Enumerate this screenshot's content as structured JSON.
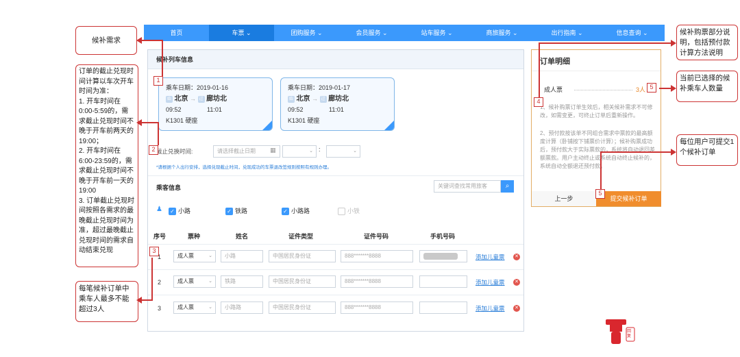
{
  "nav": {
    "items": [
      "首页",
      "车票 ⌄",
      "团购服务 ⌄",
      "会员服务 ⌄",
      "站车服务 ⌄",
      "商旅服务 ⌄",
      "出行指南 ⌄",
      "信息查询 ⌄"
    ]
  },
  "section1": {
    "title": "候补列车信息"
  },
  "tickets": [
    {
      "date": "乘车日期：2019-01-16",
      "from": "北京",
      "to": "廊坊北",
      "from_tag": "始",
      "to_tag": "过",
      "dep": "09:52",
      "arr": "11:01",
      "train": "K1301",
      "seat": "硬座"
    },
    {
      "date": "乘车日期：2019-01-17",
      "from": "北京",
      "to": "廊坊北",
      "from_tag": "始",
      "to_tag": "过",
      "dep": "09:52",
      "arr": "11:01",
      "train": "K1301",
      "seat": "硬座"
    }
  ],
  "deadline": {
    "label": "截止兑换时间:",
    "placeholder": "请选择截止日期",
    "colon": ":",
    "note": "*请根据个人出行安排，选择兑现截止时间，兑现成功的车票退改签规则按照有规则办理。"
  },
  "passengers_section": {
    "title": "乘客信息",
    "search_placeholder": "关键词查找常用旅客"
  },
  "passenger_checks": [
    {
      "name": "小路",
      "checked": true
    },
    {
      "name": "铁路",
      "checked": true
    },
    {
      "name": "小路路",
      "checked": true
    },
    {
      "name": "小铁",
      "checked": false
    }
  ],
  "table_headers": [
    "序号",
    "票种",
    "姓名",
    "证件类型",
    "证件号码",
    "手机号码"
  ],
  "rows": [
    {
      "no": "1",
      "ticket_type": "成人票",
      "name": "小路",
      "id_type": "中国居民身份证",
      "id_no": "888*******8888",
      "add_child": "添加儿童票"
    },
    {
      "no": "2",
      "ticket_type": "成人票",
      "name": "铁路",
      "id_type": "中国居民身份证",
      "id_no": "888*******8888",
      "add_child": "添加儿童票"
    },
    {
      "no": "3",
      "ticket_type": "成人票",
      "name": "小路路",
      "id_type": "中国居民身份证",
      "id_no": "888*******8888",
      "add_child": "添加儿童票"
    }
  ],
  "order": {
    "title": "订单明细",
    "item": "成人票",
    "count": "3人",
    "desc1": "1、候补购票订单生效后，相关候补需求不可修改，如需变更，可终止订单后重新操作。",
    "desc2": "2、预付款按该单不同组合需求中票款的最高额度计算（卧铺按下铺票价计算）；候补购票成功后，预付款大于实际票款的，系统将自动退回差额票款。用户主动终止或系统自动终止候补的，系统自动全额退还预付款。",
    "prev": "上一步",
    "submit": "提交候补订单"
  },
  "annotations": {
    "a_left_top": "候补需求",
    "a_left_mid": "订单的截止兑现时间计算以车次开车时间为准：\n1. 开车时间在0:00-5:59的，需求截止兑现时间不晚于开车前两天的19:00；\n2. 开车时间在6:00-23:59的，需求截止兑现时间不晚于开车前一天的19:00\n3. 订单截止兑现时间按照各需求的最晚截止兑现时间为准，超过最晚截止兑现时间的需求自动结束兑现",
    "a_left_bot": "每笔候补订单中乘车人最多不能超过3人",
    "a_right_1": "候补购票部分说明，包括预付款计算方法说明",
    "a_right_2": "当前已选择的候补乘车人数量",
    "a_right_3": "每位用户可提交1个候补订单"
  },
  "badges": [
    "1",
    "2",
    "3",
    "4",
    "5",
    "5"
  ],
  "logo": {
    "text": "回复"
  }
}
